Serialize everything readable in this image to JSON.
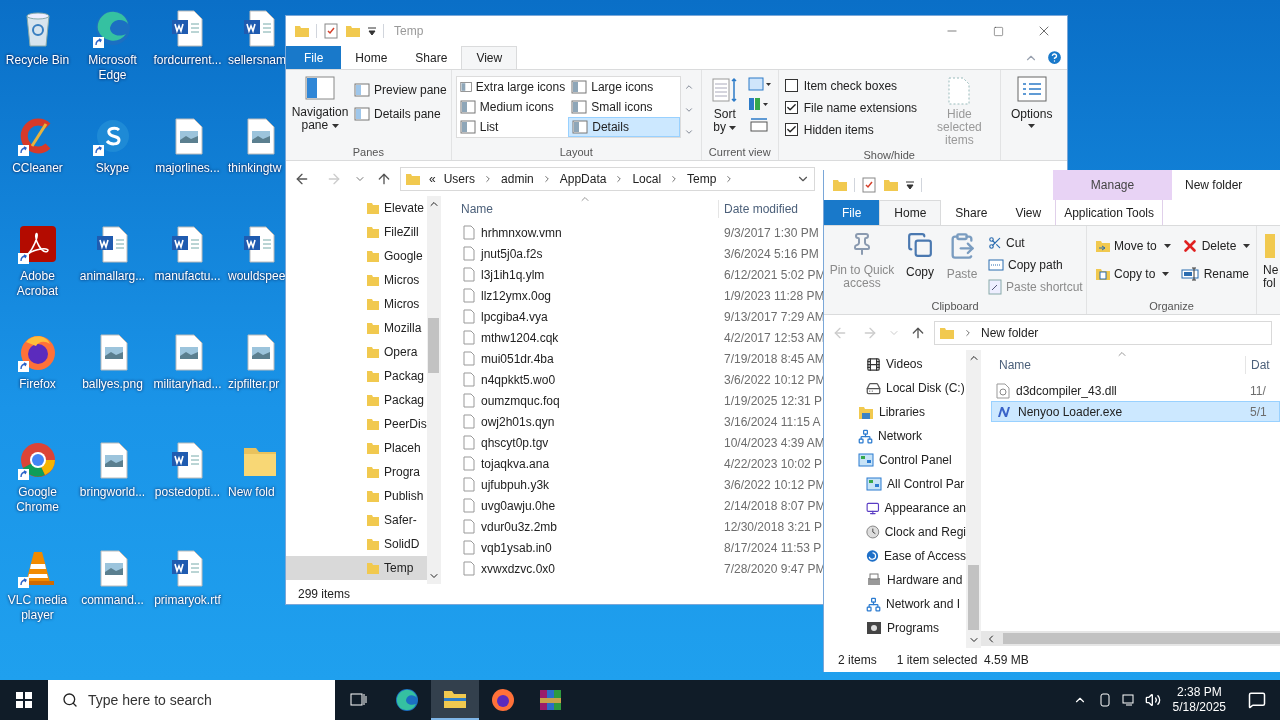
{
  "desktop": {
    "icons": [
      {
        "label": "Recycle Bin",
        "kind": "recycle",
        "shortcut": false
      },
      {
        "label": "CCleaner",
        "kind": "ccleaner",
        "shortcut": true
      },
      {
        "label": "Adobe Acrobat",
        "kind": "acrobat",
        "shortcut": true
      },
      {
        "label": "Firefox",
        "kind": "firefox",
        "shortcut": true
      },
      {
        "label": "Google Chrome",
        "kind": "chrome",
        "shortcut": true
      },
      {
        "label": "VLC media player",
        "kind": "vlc",
        "shortcut": true
      },
      {
        "label": "Microsoft Edge",
        "kind": "edge",
        "shortcut": true
      },
      {
        "label": "Skype",
        "kind": "skype",
        "shortcut": true
      },
      {
        "label": "animallarg...",
        "kind": "word",
        "shortcut": false
      },
      {
        "label": "ballyes.png",
        "kind": "image",
        "shortcut": false
      },
      {
        "label": "bringworld...",
        "kind": "image",
        "shortcut": false
      },
      {
        "label": "command...",
        "kind": "image",
        "shortcut": false
      },
      {
        "label": "fordcurrent...",
        "kind": "word",
        "shortcut": false
      },
      {
        "label": "majorlines...",
        "kind": "image",
        "shortcut": false
      },
      {
        "label": "manufactu...",
        "kind": "word",
        "shortcut": false
      },
      {
        "label": "militaryhad...",
        "kind": "image",
        "shortcut": false
      },
      {
        "label": "postedopti...",
        "kind": "word",
        "shortcut": false
      },
      {
        "label": "primaryok.rtf",
        "kind": "word",
        "shortcut": false
      },
      {
        "label": "sellersnam",
        "kind": "word",
        "shortcut": false
      },
      {
        "label": "thinkingtw",
        "kind": "image",
        "shortcut": false
      },
      {
        "label": "wouldspee",
        "kind": "word",
        "shortcut": false
      },
      {
        "label": "zipfilter.pr",
        "kind": "image",
        "shortcut": false
      },
      {
        "label": "New fold",
        "kind": "folder",
        "shortcut": false
      }
    ]
  },
  "temp_window": {
    "title": "Temp",
    "tabs": [
      {
        "label": "File",
        "kind": "file",
        "selected": false
      },
      {
        "label": "Home",
        "kind": "tab",
        "selected": false
      },
      {
        "label": "Share",
        "kind": "tab",
        "selected": false
      },
      {
        "label": "View",
        "kind": "tab",
        "selected": true
      }
    ],
    "ribbon": {
      "panes": {
        "label": "Panes",
        "navigation_pane": "Navigation pane",
        "buttons": [
          "Preview pane",
          "Details pane"
        ]
      },
      "layout": {
        "label": "Layout",
        "options": [
          {
            "label": "Extra large icons",
            "selected": false
          },
          {
            "label": "Large icons",
            "selected": false
          },
          {
            "label": "Medium icons",
            "selected": false
          },
          {
            "label": "Small icons",
            "selected": false
          },
          {
            "label": "List",
            "selected": false
          },
          {
            "label": "Details",
            "selected": true
          }
        ]
      },
      "current_view": {
        "label": "Current view",
        "sort_by": "Sort by"
      },
      "show_hide": {
        "label": "Show/hide",
        "checkboxes": [
          {
            "label": "Item check boxes",
            "checked": false
          },
          {
            "label": "File name extensions",
            "checked": true
          },
          {
            "label": "Hidden items",
            "checked": true
          }
        ],
        "hide_selected": {
          "label": "Hide selected items",
          "disabled": true
        }
      },
      "options": "Options"
    },
    "address": {
      "overflow": "«",
      "path": [
        "Users",
        "admin",
        "AppData",
        "Local",
        "Temp"
      ]
    },
    "nav_items": [
      {
        "label": "Elevate",
        "selected": false
      },
      {
        "label": "FileZill",
        "selected": false
      },
      {
        "label": "Google",
        "selected": false
      },
      {
        "label": "Micros",
        "selected": false
      },
      {
        "label": "Micros",
        "selected": false
      },
      {
        "label": "Mozilla",
        "selected": false
      },
      {
        "label": "Opera",
        "selected": false
      },
      {
        "label": "Packag",
        "selected": false
      },
      {
        "label": "Packag",
        "selected": false
      },
      {
        "label": "PeerDis",
        "selected": false
      },
      {
        "label": "Placeh",
        "selected": false
      },
      {
        "label": "Progra",
        "selected": false
      },
      {
        "label": "Publish",
        "selected": false
      },
      {
        "label": "Safer-",
        "selected": false
      },
      {
        "label": "SolidD",
        "selected": false
      },
      {
        "label": "Temp",
        "selected": true
      }
    ],
    "columns": [
      "Name",
      "Date modified"
    ],
    "files": [
      {
        "name": "hrhmnxow.vmn",
        "date": "9/3/2017 1:30 PM"
      },
      {
        "name": "jnut5j0a.f2s",
        "date": "3/6/2024 5:16 PM"
      },
      {
        "name": "l3j1ih1q.ylm",
        "date": "6/12/2021 5:02 PM"
      },
      {
        "name": "llz12ymx.0og",
        "date": "1/9/2023 11:28 PM"
      },
      {
        "name": "lpcgiba4.vya",
        "date": "9/13/2017 7:29 AM"
      },
      {
        "name": "mthw1204.cqk",
        "date": "4/2/2017 12:53 AM"
      },
      {
        "name": "mui051dr.4ba",
        "date": "7/19/2018 8:45 AM"
      },
      {
        "name": "n4qpkkt5.wo0",
        "date": "3/6/2022 10:12 PM"
      },
      {
        "name": "oumzmquc.foq",
        "date": "1/19/2025 12:31 P"
      },
      {
        "name": "owj2h01s.qyn",
        "date": "3/16/2024 11:15 A"
      },
      {
        "name": "qhscyt0p.tgv",
        "date": "10/4/2023 4:39 AM"
      },
      {
        "name": "tojaqkva.ana",
        "date": "4/22/2023 10:02 P"
      },
      {
        "name": "ujfubpuh.y3k",
        "date": "3/6/2022 10:12 PM"
      },
      {
        "name": "uvg0awju.0he",
        "date": "2/14/2018 8:07 PM"
      },
      {
        "name": "vdur0u3z.2mb",
        "date": "12/30/2018 3:21 P"
      },
      {
        "name": "vqb1ysab.in0",
        "date": "8/17/2024 11:53 P"
      },
      {
        "name": "xvwxdzvc.0x0",
        "date": "7/28/2020 9:47 PM"
      }
    ],
    "status": "299 items"
  },
  "folder_window": {
    "title": "New folder",
    "context_tab": "Manage",
    "tabs": [
      {
        "label": "File",
        "kind": "file",
        "selected": false
      },
      {
        "label": "Home",
        "kind": "tab",
        "selected": true
      },
      {
        "label": "Share",
        "kind": "tab",
        "selected": false
      },
      {
        "label": "View",
        "kind": "tab",
        "selected": false
      },
      {
        "label": "Application Tools",
        "kind": "context",
        "selected": false
      }
    ],
    "clipboard": {
      "label": "Clipboard",
      "large": [
        {
          "label": "Pin to Quick access",
          "kind": "pin",
          "disabled": true
        },
        {
          "label": "Copy",
          "kind": "copy",
          "disabled": false
        },
        {
          "label": "Paste",
          "kind": "paste",
          "disabled": true
        }
      ],
      "small": [
        {
          "label": "Cut",
          "kind": "cut",
          "disabled": false
        },
        {
          "label": "Copy path",
          "kind": "path",
          "disabled": false
        },
        {
          "label": "Paste shortcut",
          "kind": "shortcut",
          "disabled": true
        }
      ]
    },
    "organize": {
      "label": "Organize",
      "buttons": [
        {
          "label": "Move to",
          "kind": "move"
        },
        {
          "label": "Delete",
          "kind": "delete"
        },
        {
          "label": "Copy to",
          "kind": "copyto"
        },
        {
          "label": "Rename",
          "kind": "rename"
        }
      ]
    },
    "new_folder": [
      "Ne",
      "fol"
    ],
    "address": [
      "New folder"
    ],
    "pc_items": [
      {
        "label": "Videos",
        "kind": "videos"
      },
      {
        "label": "Local Disk (C:)",
        "kind": "disk"
      }
    ],
    "tree": [
      {
        "label": "Libraries",
        "kind": "libraries"
      },
      {
        "label": "Network",
        "kind": "network"
      },
      {
        "label": "Control Panel",
        "kind": "control",
        "children": [
          {
            "label": "All Control Par",
            "kind": "control"
          },
          {
            "label": "Appearance an",
            "kind": "appearance"
          },
          {
            "label": "Clock and Regi",
            "kind": "clock"
          },
          {
            "label": "Ease of Access",
            "kind": "ease"
          },
          {
            "label": "Hardware and",
            "kind": "hardware"
          },
          {
            "label": "Network and I",
            "kind": "network"
          },
          {
            "label": "Programs",
            "kind": "programs"
          }
        ]
      }
    ],
    "columns": [
      "Name",
      "Dat"
    ],
    "files": [
      {
        "name": "d3dcompiler_43.dll",
        "date": "11/",
        "kind": "dll",
        "selected": false
      },
      {
        "name": "Nenyoo Loader.exe",
        "date": "5/1",
        "kind": "exe",
        "selected": true
      }
    ],
    "status": [
      "2 items",
      "1 item selected  4.59 MB"
    ]
  },
  "taskbar": {
    "search_placeholder": "Type here to search",
    "apps": [
      {
        "kind": "taskview",
        "selected": false
      },
      {
        "kind": "edge",
        "selected": false
      },
      {
        "kind": "explorer",
        "selected": true
      },
      {
        "kind": "firefox",
        "selected": false
      },
      {
        "kind": "winrar",
        "selected": false
      }
    ],
    "time": "2:38 PM",
    "date": "5/18/2025"
  }
}
